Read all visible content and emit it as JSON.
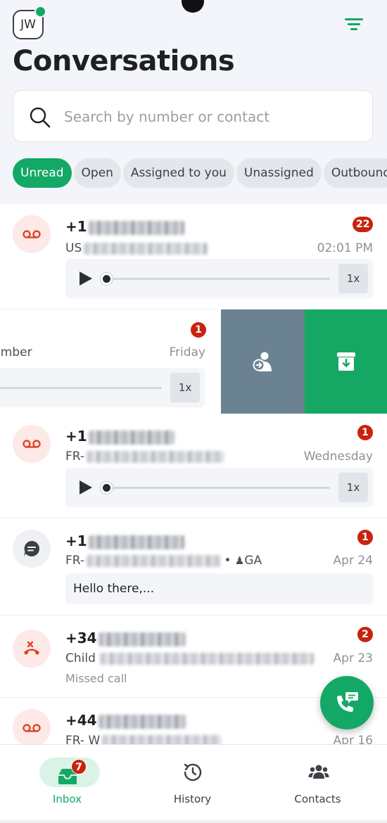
{
  "header": {
    "avatar_initials": "JW",
    "title": "Conversations"
  },
  "search": {
    "placeholder": "Search by number or contact",
    "value": ""
  },
  "filters": [
    "Unread",
    "Open",
    "Assigned to you",
    "Unassigned",
    "Outbound"
  ],
  "active_filter": "Unread",
  "conversations": [
    {
      "type": "voicemail",
      "phone_prefix": "+1",
      "sub_prefix": "US",
      "time": "02:01 PM",
      "unread": "22",
      "speed": "1x"
    },
    {
      "type": "voicemail",
      "sub_suffix": "umber",
      "time": "Friday",
      "unread": "1",
      "speed": "1x",
      "swiped": true
    },
    {
      "type": "voicemail",
      "phone_prefix": "+1",
      "sub_prefix": "FR-",
      "time": "Wednesday",
      "unread": "1",
      "speed": "1x"
    },
    {
      "type": "message",
      "phone_prefix": "+1",
      "sub_prefix": "FR-",
      "separator": "•",
      "assignee": "GA",
      "time": "Apr 24",
      "unread": "1",
      "preview": "Hello there,..."
    },
    {
      "type": "missed",
      "phone_prefix": "+34",
      "sub_prefix": "Child",
      "time": "Apr 23",
      "unread": "2",
      "status": "Missed call"
    },
    {
      "type": "voicemail",
      "phone_prefix": "+44",
      "sub_prefix": "FR- W",
      "time": "Apr 16",
      "unread": ""
    }
  ],
  "tabs": [
    {
      "label": "Inbox",
      "badge": "7",
      "icon": "inbox-icon",
      "active": true
    },
    {
      "label": "History",
      "icon": "history-icon",
      "active": false
    },
    {
      "label": "Contacts",
      "icon": "contacts-icon",
      "active": false
    }
  ],
  "colors": {
    "accent": "#13a865",
    "badge": "#c8230e",
    "voicemail_icon": "#e0442c",
    "assign_action": "#6b8292"
  }
}
